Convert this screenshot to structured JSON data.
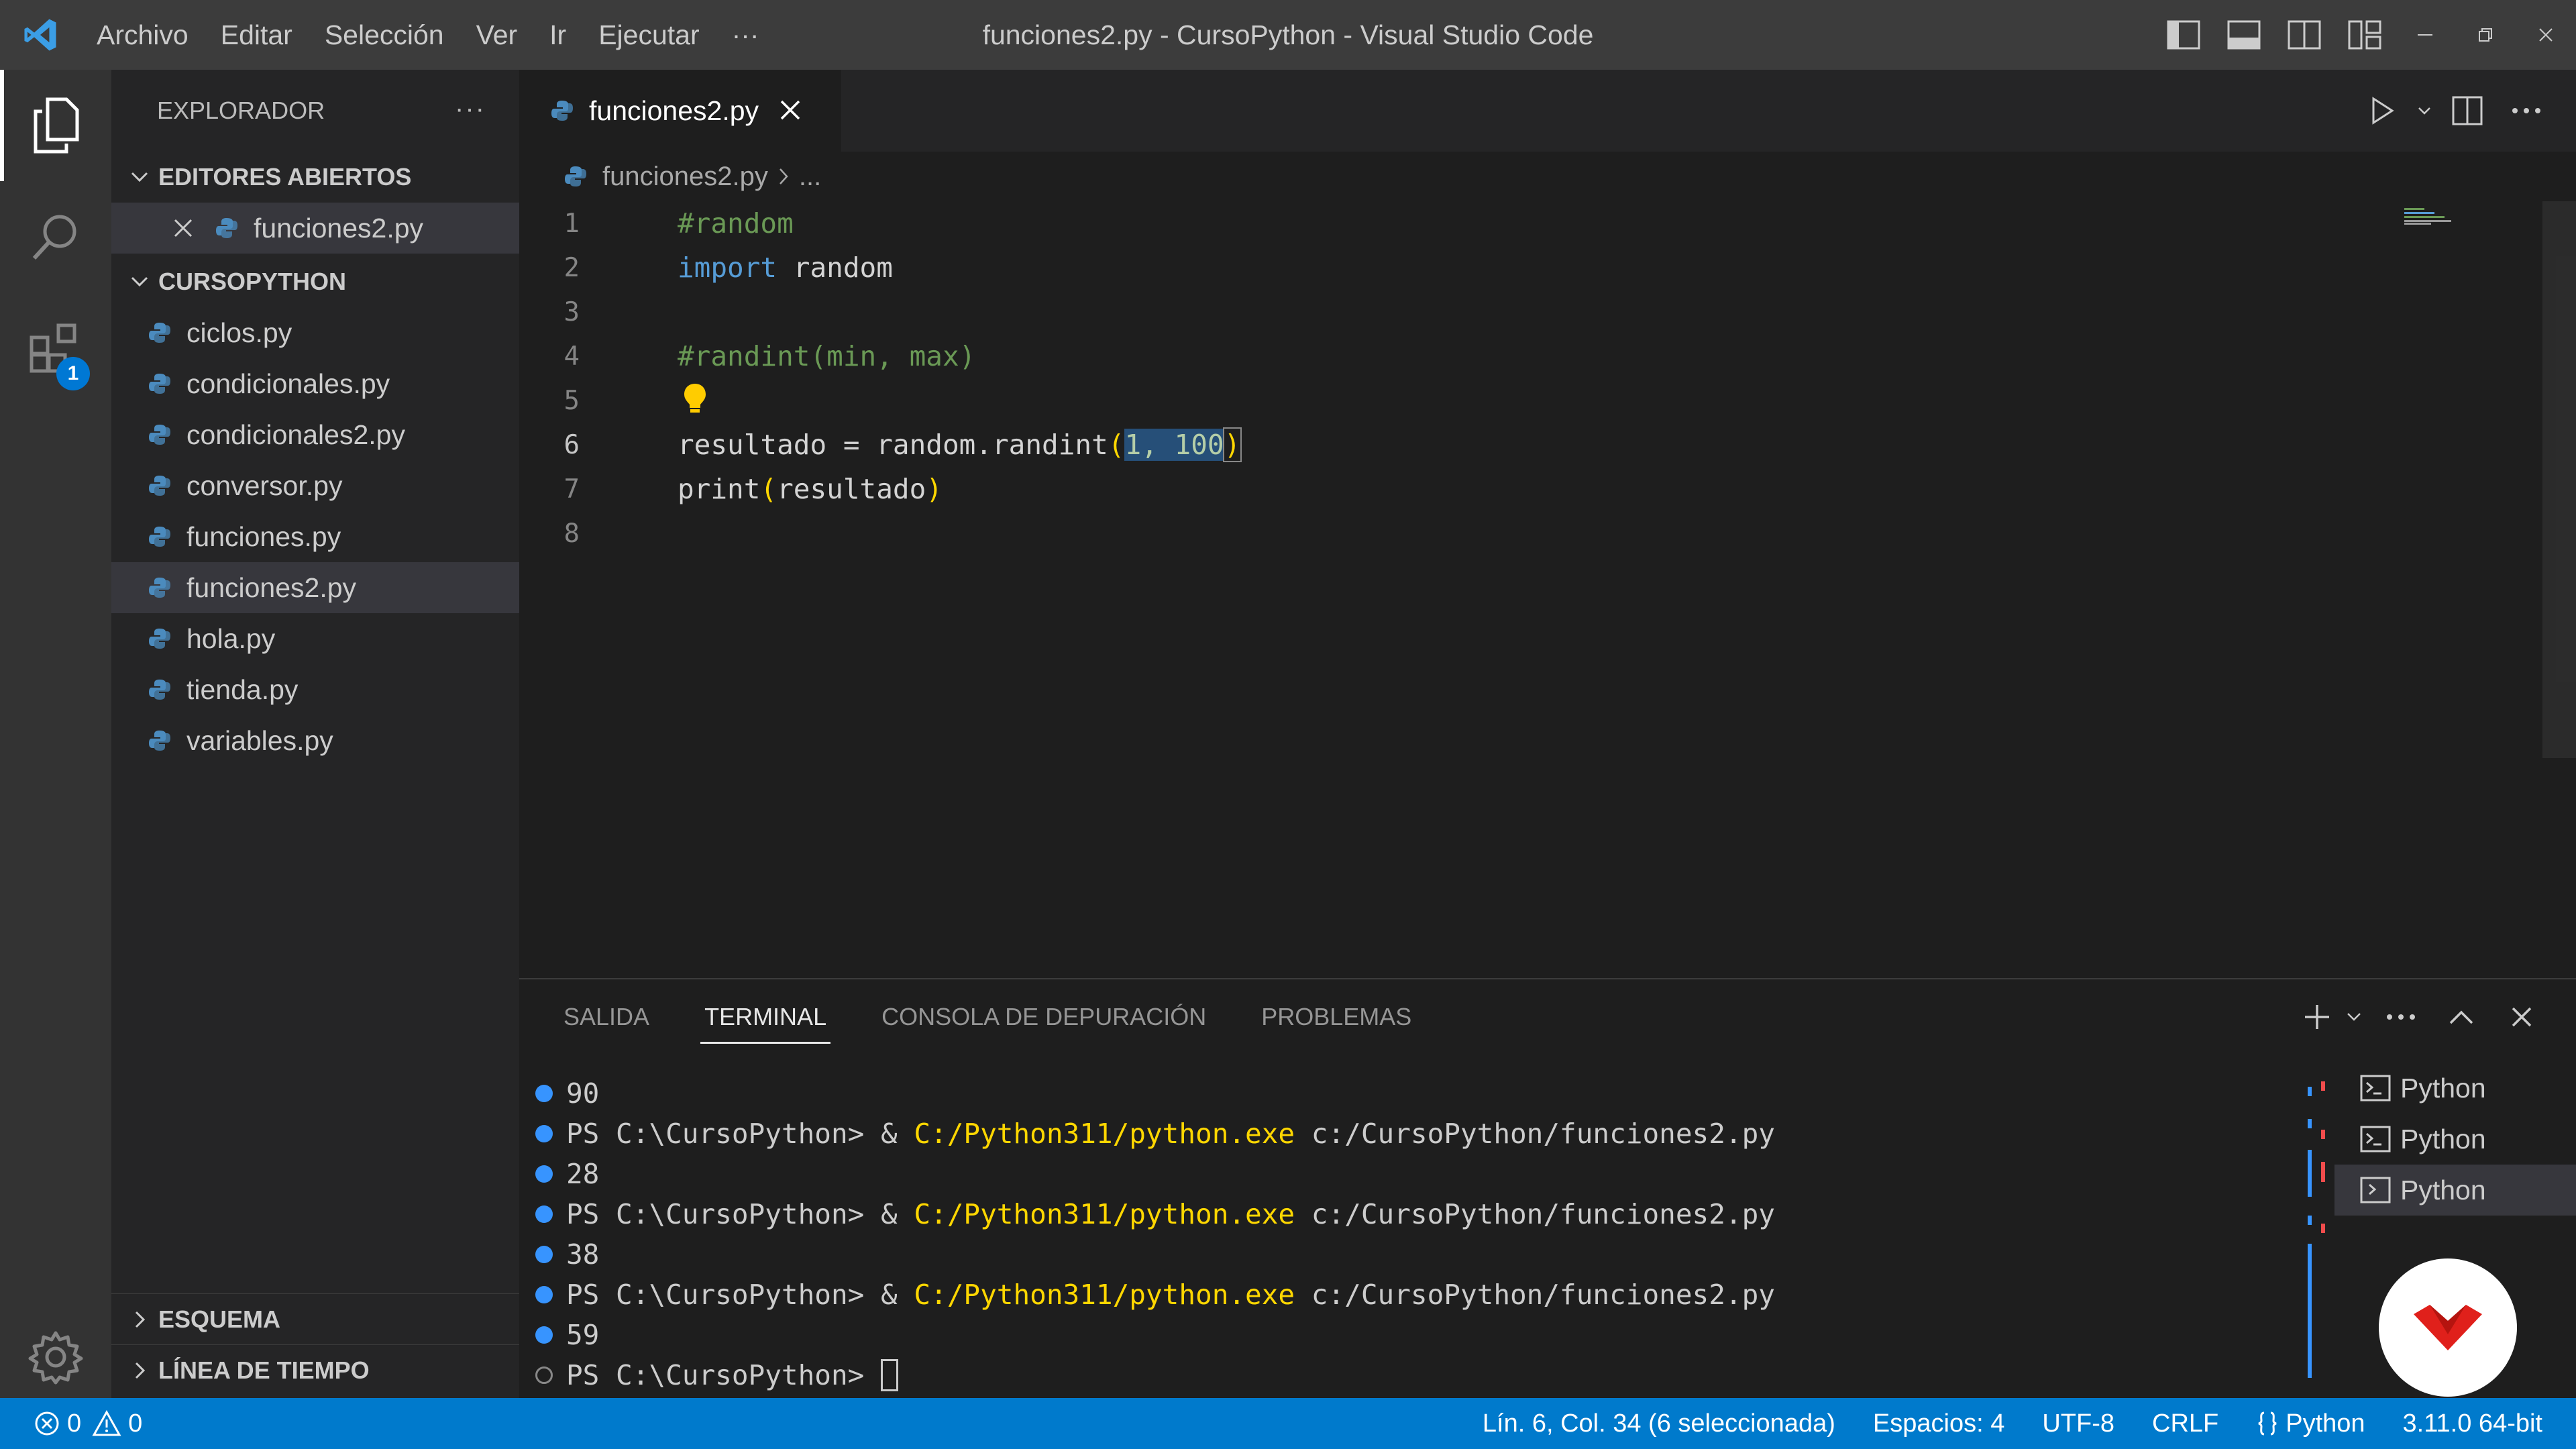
{
  "titlebar": {
    "menu": [
      "Archivo",
      "Editar",
      "Selección",
      "Ver",
      "Ir",
      "Ejecutar",
      "···"
    ],
    "title": "funciones2.py - CursoPython - Visual Studio Code"
  },
  "activity": {
    "extensions_badge": "1"
  },
  "sidebar": {
    "header": "EXPLORADOR",
    "header_more": "···",
    "open_editors_label": "EDITORES ABIERTOS",
    "open_editors": [
      {
        "name": "funciones2.py"
      }
    ],
    "folder_label": "CURSOPYTHON",
    "files": [
      {
        "name": "ciclos.py"
      },
      {
        "name": "condicionales.py"
      },
      {
        "name": "condicionales2.py"
      },
      {
        "name": "conversor.py"
      },
      {
        "name": "funciones.py"
      },
      {
        "name": "funciones2.py",
        "selected": true
      },
      {
        "name": "hola.py"
      },
      {
        "name": "tienda.py"
      },
      {
        "name": "variables.py"
      }
    ],
    "outline_label": "ESQUEMA",
    "timeline_label": "LÍNEA DE TIEMPO"
  },
  "editor": {
    "tab_label": "funciones2.py",
    "breadcrumb_file": "funciones2.py",
    "breadcrumb_more": "...",
    "lines": [
      {
        "n": "1",
        "text": "#random"
      },
      {
        "n": "2",
        "text": "import random"
      },
      {
        "n": "3",
        "text": ""
      },
      {
        "n": "4",
        "text": "#randint(min, max)"
      },
      {
        "n": "5",
        "text": ""
      },
      {
        "n": "6",
        "text": "resultado = random.randint(1, 100)"
      },
      {
        "n": "7",
        "text": "print(resultado)"
      },
      {
        "n": "8",
        "text": ""
      }
    ],
    "tokens": {
      "l1_comment": "#random",
      "l2_kw": "import",
      "l2_rest": " random",
      "l4_comment": "#randint(min, max)",
      "l6_pre": "resultado = random.randint",
      "l6_open": "(",
      "l6_sel": "1, 100",
      "l6_close": ")",
      "l7_pre": "print",
      "l7_open": "(",
      "l7_mid": "resultado",
      "l7_close": ")"
    }
  },
  "panel": {
    "tabs": [
      "SALIDA",
      "TERMINAL",
      "CONSOLA DE DEPURACIÓN",
      "PROBLEMAS"
    ],
    "active_tab": "TERMINAL",
    "terminal": {
      "prompt": "PS C:\\CursoPython> ",
      "amp": "& ",
      "exe": "C:/Python311/python.exe",
      "script": " c:/CursoPython/funciones2.py",
      "outputs": [
        "90",
        "28",
        "38",
        "59"
      ]
    },
    "terminals": [
      "Python",
      "Python",
      "Python"
    ]
  },
  "statusbar": {
    "errors": "0",
    "warnings": "0",
    "position": "Lín. 6, Col. 34 (6 seleccionada)",
    "spaces": "Espacios: 4",
    "encoding": "UTF-8",
    "eol": "CRLF",
    "language": "Python",
    "interpreter": "3.11.0 64-bit"
  },
  "colors": {
    "accent": "#007acc",
    "comment": "#6a9955",
    "keyword": "#569cd6",
    "bracket": "#ffd700",
    "number": "#b5cea8",
    "selection": "#264f78"
  },
  "icons": [
    "vscode-logo-icon",
    "files-icon",
    "search-icon",
    "extensions-icon",
    "gear-icon",
    "python-file-icon",
    "lightbulb-icon",
    "terminal-icon",
    "play-icon",
    "split-editor-icon",
    "error-icon",
    "warning-icon",
    "watermark-logo"
  ]
}
